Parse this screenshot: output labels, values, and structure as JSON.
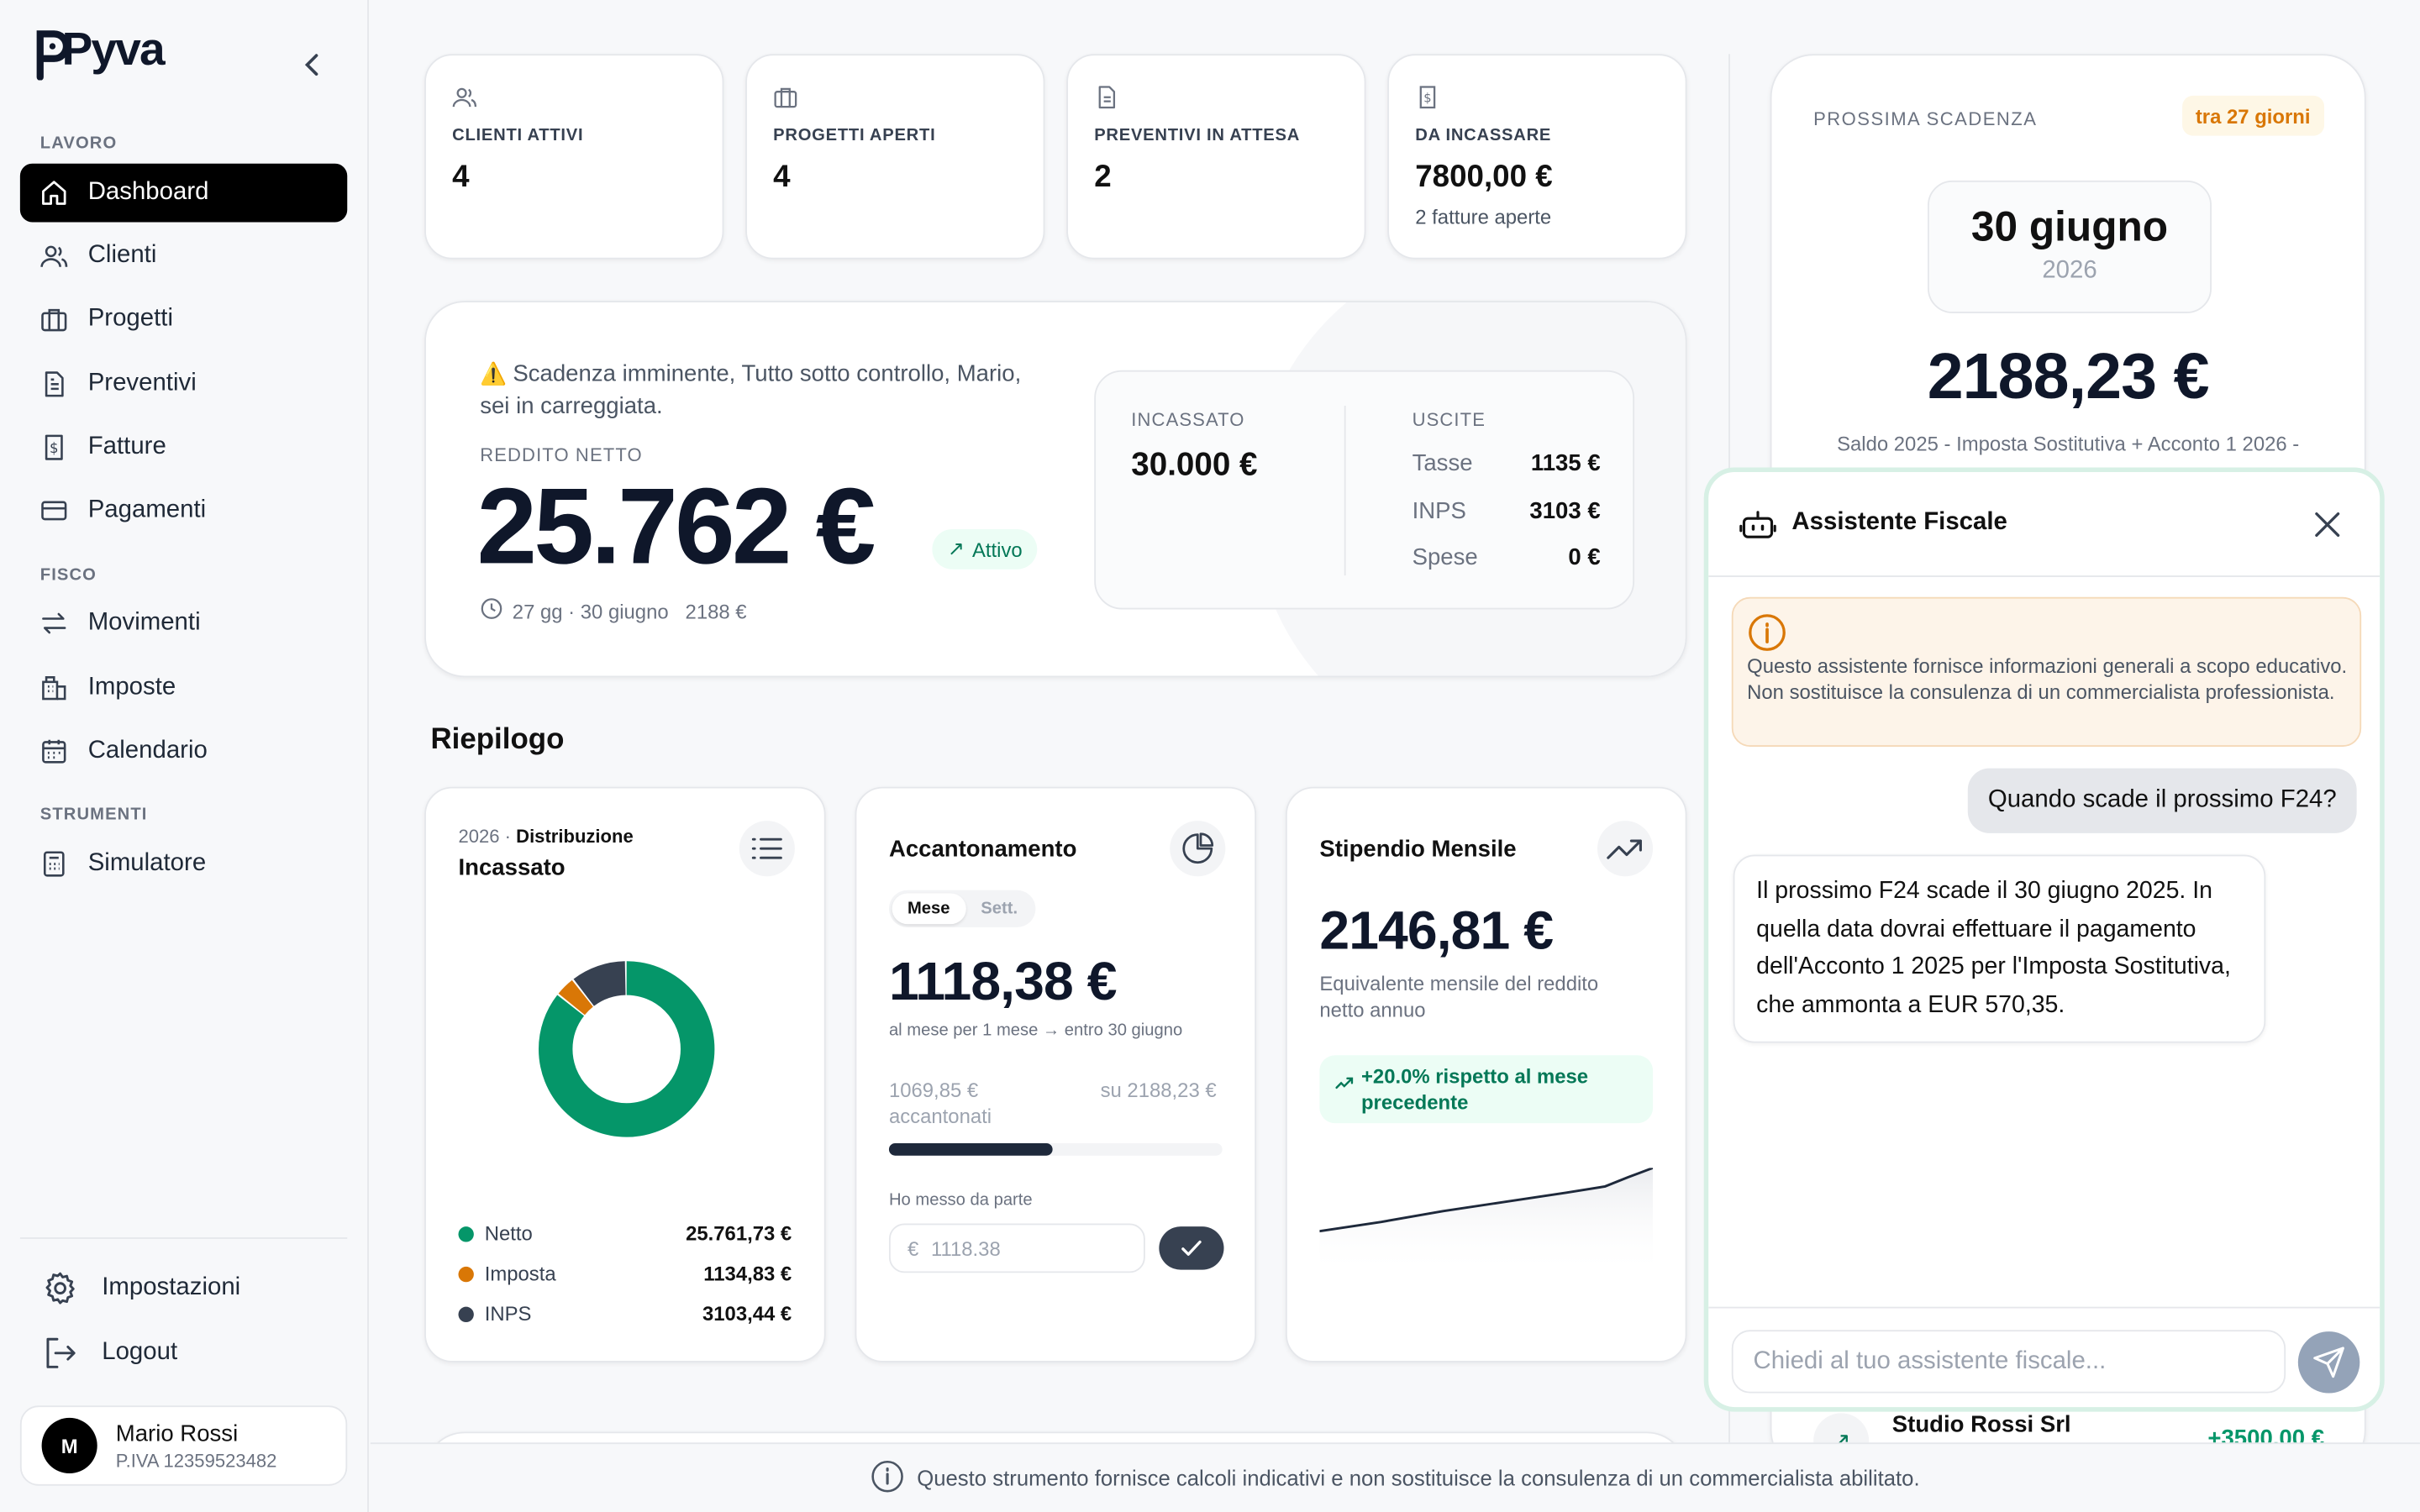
{
  "app": {
    "name": "Pyva"
  },
  "sidebar": {
    "sections": [
      "LAVORO",
      "FISCO",
      "STRUMENTI"
    ],
    "items": [
      {
        "label": "Dashboard",
        "icon": "home-icon"
      },
      {
        "label": "Clienti",
        "icon": "users-icon"
      },
      {
        "label": "Progetti",
        "icon": "briefcase-icon"
      },
      {
        "label": "Preventivi",
        "icon": "document-icon"
      },
      {
        "label": "Fatture",
        "icon": "invoice-icon"
      },
      {
        "label": "Pagamenti",
        "icon": "credit-card-icon"
      },
      {
        "label": "Movimenti",
        "icon": "arrows-icon"
      },
      {
        "label": "Imposte",
        "icon": "building-icon"
      },
      {
        "label": "Calendario",
        "icon": "calendar-icon"
      },
      {
        "label": "Simulatore",
        "icon": "calculator-icon"
      }
    ],
    "settings_label": "Impostazioni",
    "logout_label": "Logout",
    "user": {
      "initial": "M",
      "name": "Mario Rossi",
      "vat": "P.IVA 12359523482"
    }
  },
  "kpis": [
    {
      "label": "CLIENTI ATTIVI",
      "value": "4"
    },
    {
      "label": "PROGETTI APERTI",
      "value": "4"
    },
    {
      "label": "PREVENTIVI IN ATTESA",
      "value": "2"
    },
    {
      "label": "DA INCASSARE",
      "value": "7800,00 €",
      "sub": "2 fatture aperte"
    }
  ],
  "hero": {
    "message": "Scadenza imminente, Tutto sotto controllo, Mario, sei in carreggiata.",
    "label": "REDDITO NETTO",
    "value": "25.762 €",
    "status": "Attivo",
    "sub": "27 gg · 30 giugno   2188 €",
    "incassato_label": "INCASSATO",
    "incassato_value": "30.000 €",
    "uscite_label": "USCITE",
    "uscite": [
      {
        "name": "Tasse",
        "value": "1135 €"
      },
      {
        "name": "INPS",
        "value": "3103 €"
      },
      {
        "name": "Spese",
        "value": "0 €"
      }
    ]
  },
  "summary": {
    "title": "Riepilogo",
    "dist": {
      "year": "2026",
      "sep": " · ",
      "kind": "Distribuzione",
      "title": "Incassato",
      "legend": [
        {
          "name": "Netto",
          "value": "25.761,73 €"
        },
        {
          "name": "Imposta",
          "value": "1134,83 €"
        },
        {
          "name": "INPS",
          "value": "3103,44 €"
        }
      ]
    },
    "saving": {
      "title": "Accantonamento",
      "tab_month": "Mese",
      "tab_week": "Sett.",
      "value": "1118,38 €",
      "caption": "al mese per 1 mese → entro 30 giugno",
      "saved": "1069,85 € accantonati",
      "target": "su 2188,23 €",
      "progress": 0.489,
      "input_label": "Ho messo da parte",
      "input_placeholder": "1118.38",
      "currency": "€"
    },
    "salary": {
      "title": "Stipendio Mensile",
      "value": "2146,81 €",
      "caption": "Equivalente mensile del reddito netto annuo",
      "trend": "+20.0% rispetto al mese precedente"
    }
  },
  "chart_data": {
    "type": "pie",
    "title": "Incassato",
    "categories": [
      "Netto",
      "Imposta",
      "INPS"
    ],
    "values": [
      25761.73,
      1134.83,
      3103.44
    ],
    "colors": [
      "#059669",
      "#d97706",
      "#374151"
    ]
  },
  "deadline": {
    "label": "PROSSIMA SCADENZA",
    "badge": "tra 27 giorni",
    "date": "30 giugno",
    "year": "2026",
    "amount": "2188,23 €",
    "sub": "Saldo 2025 - Imposta Sostitutiva + Acconto 1 2026 -"
  },
  "assistant": {
    "title": "Assistente Fiscale",
    "disclaimer": "Questo assistente fornisce informazioni generali a scopo educativo. Non sostituisce la consulenza di un commercialista professionista.",
    "user_message": "Quando scade il prossimo F24?",
    "bot_message": "Il prossimo F24 scade il 30 giugno 2025. In quella data dovrai effettuare il pagamento dell'Acconto 1 2025 per l'Imposta Sostitutiva, che ammonta a EUR 570,35.",
    "input_placeholder": "Chiedi al tuo assistente fiscale..."
  },
  "peek": {
    "name": "Studio Rossi Srl",
    "amount": "+3500,00 €"
  },
  "footer": {
    "text": "Questo strumento fornisce calcoli indicativi e non sostituisce la consulenza di un commercialista abilitato."
  }
}
